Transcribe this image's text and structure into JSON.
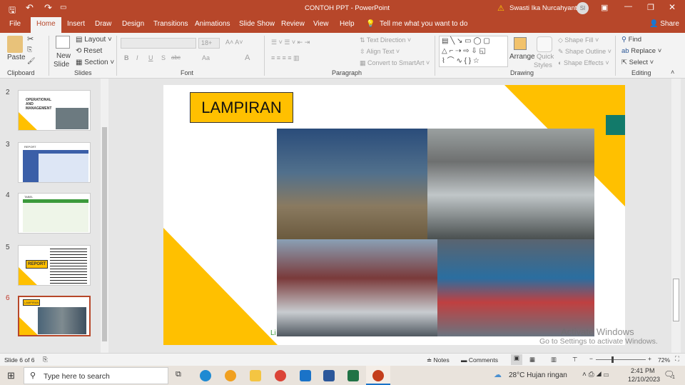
{
  "window": {
    "title": "CONTOH PPT  -  PowerPoint",
    "user": "Swasti Ika Nurcahyanti",
    "user_initials": "SI"
  },
  "tabs": [
    "File",
    "Home",
    "Insert",
    "Draw",
    "Design",
    "Transitions",
    "Animations",
    "Slide Show",
    "Review",
    "View",
    "Help"
  ],
  "tell_me": "Tell me what you want to do",
  "share": "Share",
  "ribbon": {
    "clipboard": {
      "paste": "Paste",
      "group": "Clipboard"
    },
    "slides": {
      "new_slide_1": "New",
      "new_slide_2": "Slide",
      "layout": "Layout",
      "reset": "Reset",
      "section": "Section",
      "group": "Slides"
    },
    "font": {
      "size": "18+",
      "group": "Font",
      "bold": "B",
      "italic": "I",
      "underline": "U",
      "shadow": "S",
      "strike": "abc",
      "case": "Aa",
      "color": "A"
    },
    "paragraph": {
      "text_direction": "Text Direction",
      "align_text": "Align Text",
      "smartart": "Convert to SmartArt",
      "group": "Paragraph"
    },
    "drawing": {
      "arrange": "Arrange",
      "quick_styles_1": "Quick",
      "quick_styles_2": "Styles",
      "shape_fill": "Shape Fill",
      "shape_outline": "Shape Outline",
      "shape_effects": "Shape Effects",
      "group": "Drawing"
    },
    "editing": {
      "find": "Find",
      "replace": "Replace",
      "select": "Select",
      "group": "Editing"
    }
  },
  "thumbnails": [
    {
      "num": "2",
      "title": "OPERATIONAL AND MANAGEMENT"
    },
    {
      "num": "3",
      "title": "REPORT"
    },
    {
      "num": "4",
      "title": "TABEL"
    },
    {
      "num": "5",
      "title": "REPORT"
    },
    {
      "num": "6",
      "title": "LAMPIRAN",
      "active": true
    }
  ],
  "slide": {
    "title": "LAMPIRAN",
    "footer_text": "Li"
  },
  "watermark": {
    "line1": "Activate Windows",
    "line2": "Go to Settings to activate Windows."
  },
  "status": {
    "slide_info": "Slide 6 of 6",
    "notes": "Notes",
    "comments": "Comments",
    "zoom": "72%"
  },
  "taskbar": {
    "search_placeholder": "Type here to search",
    "weather": "28°C  Hujan ringan",
    "time": "2:41 PM",
    "date": "12/10/2023",
    "notif_count": "1"
  },
  "colors": {
    "accent": "#b7472a",
    "slide_yellow": "#ffc000",
    "teal": "#127a6a"
  }
}
